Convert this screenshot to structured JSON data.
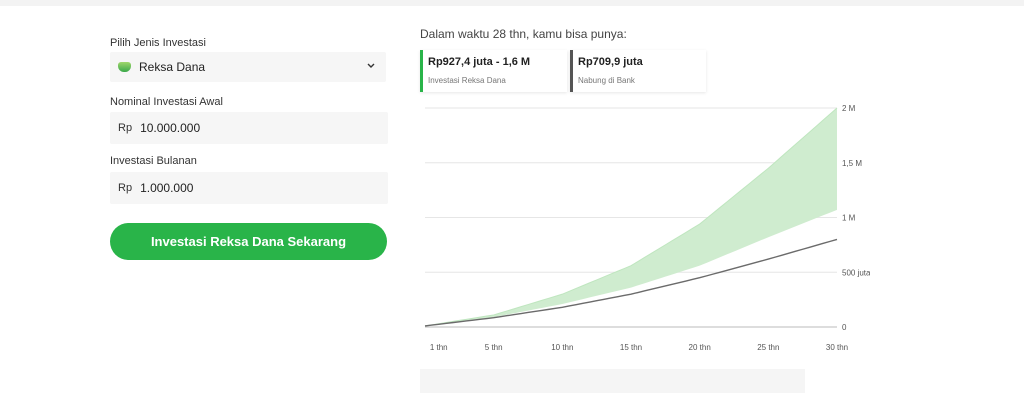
{
  "form": {
    "jenis_label": "Pilih Jenis Investasi",
    "jenis_value": "Reksa Dana",
    "awal_label": "Nominal Investasi Awal",
    "awal_currency": "Rp",
    "awal_value": "10.000.000",
    "bulanan_label": "Investasi Bulanan",
    "bulanan_currency": "Rp",
    "bulanan_value": "1.000.000",
    "cta_label": "Investasi Reksa Dana Sekarang"
  },
  "result": {
    "headline": "Dalam waktu 28 thn, kamu bisa punya:",
    "cards": [
      {
        "value": "Rp927,4 juta - 1,6 M",
        "label": "Investasi Reksa Dana",
        "accent": "#29b449"
      },
      {
        "value": "Rp709,9 juta",
        "label": "Nabung di Bank",
        "accent": "#555555"
      }
    ]
  },
  "colors": {
    "brand": "#29b449",
    "band": "#cfeccf",
    "bank_line": "#6b6b6b"
  },
  "chart_data": {
    "type": "area",
    "x": [
      0,
      5,
      10,
      15,
      20,
      25,
      30
    ],
    "xtick_labels": [
      "1 thn",
      "5 thn",
      "10 thn",
      "15 thn",
      "20 thn",
      "25 thn",
      "30 thn"
    ],
    "ytick_values": [
      0,
      500,
      1000,
      1500,
      2000
    ],
    "ytick_labels": [
      "0",
      "500 juta",
      "1 M",
      "1,5 M",
      "2 M"
    ],
    "ylim": [
      0,
      2000
    ],
    "xlim": [
      0,
      30
    ],
    "series": [
      {
        "name": "Investasi Reksa Dana (bawah)",
        "values": [
          10,
          90,
          210,
          360,
          560,
          820,
          1070
        ]
      },
      {
        "name": "Investasi Reksa Dana (atas)",
        "values": [
          10,
          110,
          300,
          560,
          940,
          1450,
          2000
        ]
      },
      {
        "name": "Nabung di Bank",
        "values": [
          10,
          85,
          180,
          300,
          450,
          620,
          800
        ]
      }
    ],
    "grid": true
  }
}
